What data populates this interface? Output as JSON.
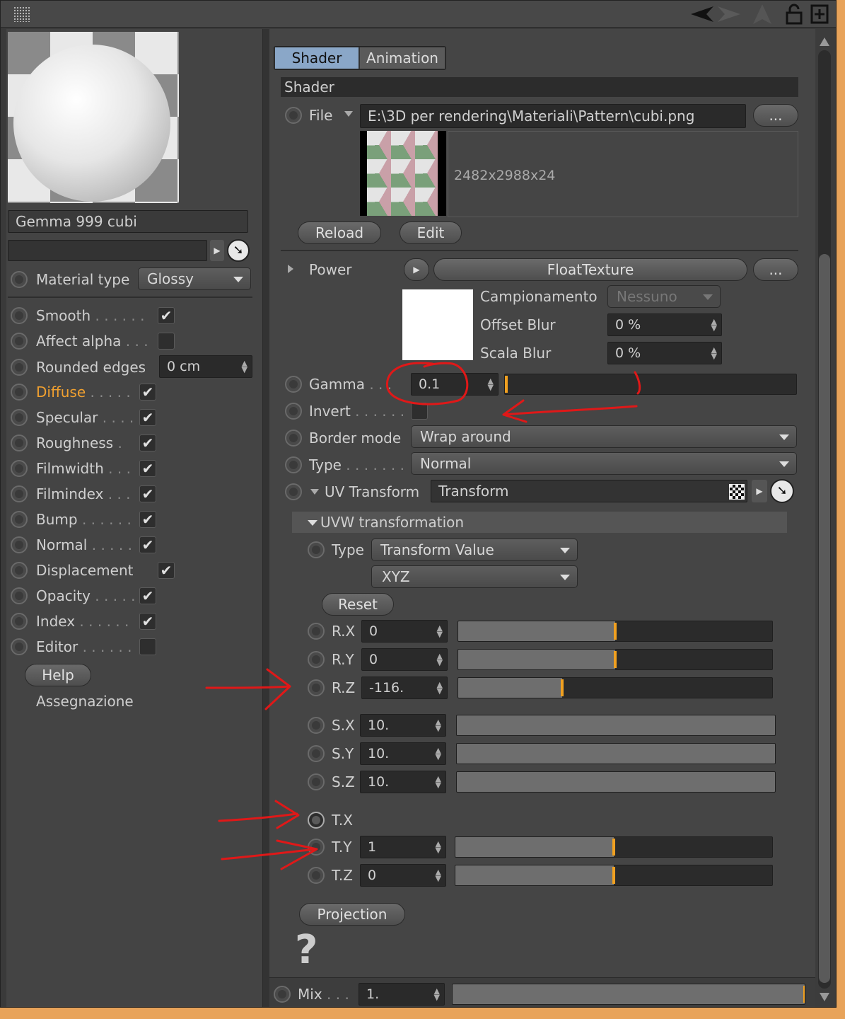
{
  "tabs": [
    "Shader",
    "Animation"
  ],
  "section_title": "Shader",
  "material": {
    "name": "Gemma 999 cubi",
    "material_type_label": "Material type",
    "material_type_value": "Glossy",
    "properties": [
      {
        "label": "Smooth",
        "dots": ". . . . . .",
        "checked": true,
        "highlight": false
      },
      {
        "label": "Affect alpha",
        "dots": ". . .",
        "checked": false,
        "highlight": false
      },
      {
        "label": "Diffuse",
        "dots": ". . . . .",
        "checked": true,
        "highlight": true
      },
      {
        "label": "Specular",
        "dots": ". . . .",
        "checked": true,
        "highlight": false
      },
      {
        "label": "Roughness",
        "dots": ".",
        "checked": true,
        "highlight": false
      },
      {
        "label": "Filmwidth",
        "dots": ". . .",
        "checked": true,
        "highlight": false
      },
      {
        "label": "Filmindex",
        "dots": ". . .",
        "checked": true,
        "highlight": false
      },
      {
        "label": "Bump",
        "dots": ". . . . . .",
        "checked": true,
        "highlight": false
      },
      {
        "label": "Normal",
        "dots": ". . . . .",
        "checked": true,
        "highlight": false
      },
      {
        "label": "Displacement",
        "dots": "",
        "checked": true,
        "highlight": false
      },
      {
        "label": "Opacity",
        "dots": ". . . . .",
        "checked": true,
        "highlight": false
      },
      {
        "label": "Index",
        "dots": ". . . . . .",
        "checked": true,
        "highlight": false
      },
      {
        "label": "Editor",
        "dots": ". . . . . .",
        "checked": false,
        "highlight": false
      }
    ],
    "rounded_edges_label": "Rounded edges",
    "rounded_edges_value": "0 cm",
    "help_label": "Help",
    "assign_label": "Assegnazione"
  },
  "file": {
    "label": "File",
    "path": "E:\\3D per rendering\\Materiali\\Pattern\\cubi.png",
    "browse": "...",
    "resolution": "2482x2988x24",
    "reload": "Reload",
    "edit": "Edit"
  },
  "power": {
    "label": "Power",
    "shader": "FloatTexture",
    "more": "...",
    "sampling_label": "Campionamento",
    "sampling_value": "Nessuno",
    "offset_blur_label": "Offset Blur",
    "offset_blur_value": "0 %",
    "scale_blur_label": "Scala Blur",
    "scale_blur_value": "0 %"
  },
  "gamma": {
    "label": "Gamma",
    "dots": ". . .",
    "value": "0.1",
    "level": 0.0
  },
  "invert": {
    "label": "Invert",
    "dots": ". . . . . ."
  },
  "border_mode": {
    "label": "Border mode",
    "value": "Wrap around"
  },
  "type_row": {
    "label": "Type",
    "dots": ". . . . . . .",
    "value": "Normal"
  },
  "uv_transform": {
    "label": "UV Transform",
    "value": "Transform"
  },
  "uvw": {
    "title": "UVW transformation",
    "type_label": "Type",
    "type_value": "Transform Value",
    "order_value": "XYZ",
    "reset": "Reset"
  },
  "rotation": [
    {
      "label": "R.X",
      "value": "0",
      "level": 0.5
    },
    {
      "label": "R.Y",
      "value": "0",
      "level": 0.5
    },
    {
      "label": "R.Z",
      "value": "-116.",
      "level": 0.33
    }
  ],
  "scale": [
    {
      "label": "S.X",
      "value": "10.",
      "level": 1.0
    },
    {
      "label": "S.Y",
      "value": "10.",
      "level": 1.0
    },
    {
      "label": "S.Z",
      "value": "10.",
      "level": 1.0
    }
  ],
  "translation": [
    {
      "label": "T.X"
    },
    {
      "label": "T.Y",
      "value": "1",
      "level": 0.5
    },
    {
      "label": "T.Z",
      "value": "0",
      "level": 0.5
    }
  ],
  "projection": "Projection",
  "help_icon": "?",
  "mix": {
    "label": "Mix",
    "dots": ". . .",
    "value": "1.",
    "level": 1.0
  },
  "colors": {
    "accent": "#f0a020",
    "annotation": "#e01818",
    "highlight_text": "#f0a030"
  }
}
